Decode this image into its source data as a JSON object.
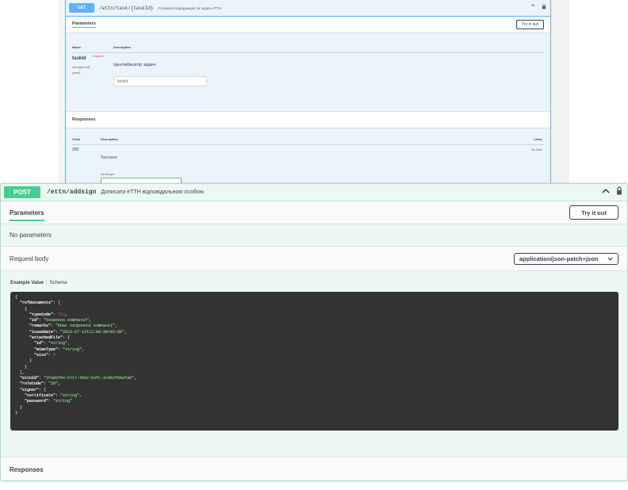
{
  "get_op": {
    "method": "GET",
    "path": "/ettn/task/{taskId}",
    "description": "Отримати інформацію по задачі еТТН",
    "parameters_title": "Parameters",
    "try_label": "Try it out",
    "col_name": "Name",
    "col_description": "Description",
    "param": {
      "name": "taskId",
      "required": "* required",
      "type": "string($uuid)",
      "location": "(path)",
      "description": "Ідентифікатор задачі",
      "placeholder": "taskId"
    },
    "responses_title": "Responses",
    "col_code": "Code",
    "col_links": "Links",
    "response": {
      "code": "200",
      "description": "Success",
      "links": "No links",
      "media_label": "Media type"
    }
  },
  "post_op": {
    "method": "POST",
    "path": "/ettn/addsign",
    "description": "Дописати еТТН відповідальною особою",
    "parameters_title": "Parameters",
    "try_label": "Try it out",
    "no_params": "No parameters",
    "request_body_label": "Request body",
    "content_type": "application/json-patch+json",
    "tab_example": "Example Value",
    "tab_schema": "Schema",
    "responses_title": "Responses",
    "example_json": {
      "refDocuments": [
        {
          "typeCode": 712,
          "id": "Охоронна компанія",
          "remarks": "Опис охоронної компанії",
          "issueDate": "2023-07-13T12:00:00+03:00",
          "attachedFile": {
            "id": "string",
            "mimeType": "string",
            "size": 0
          }
        }
      ],
      "ettnId": "3fa85f64-5717-4562-b3fc-2c963f66afa6",
      "roleCode": "20",
      "signer": {
        "certificate": "string",
        "password": "string"
      }
    }
  },
  "colors": {
    "get_accent": "#61affe",
    "post_accent": "#49cc90",
    "code_bg": "#333333",
    "string_color": "#a2fca2",
    "number_color": "#d36363"
  }
}
